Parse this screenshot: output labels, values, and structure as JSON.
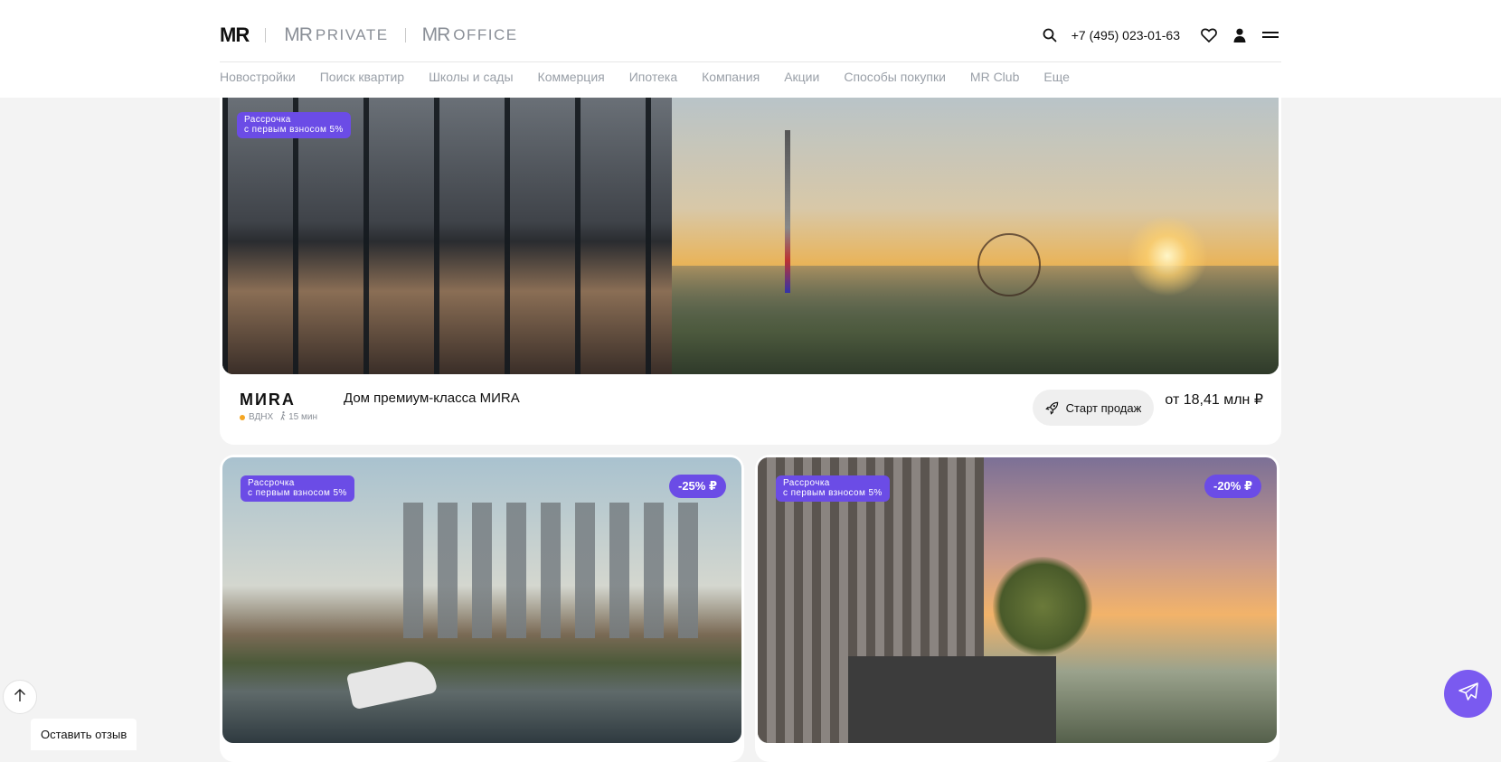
{
  "header": {
    "logos": [
      {
        "mark": "MR",
        "word": ""
      },
      {
        "mark": "MR",
        "word": "PRIVATE"
      },
      {
        "mark": "MR",
        "word": "OFFICE"
      }
    ],
    "phone": "+7 (495) 023-01-63",
    "icons": [
      "search-icon",
      "heart-icon",
      "user-icon",
      "menu-icon"
    ]
  },
  "nav": {
    "items": [
      "Новостройки",
      "Поиск квартир",
      "Школы и сады",
      "Коммерция",
      "Ипотека",
      "Компания",
      "Акции",
      "Способы покупки",
      "MR Club",
      "Еще"
    ]
  },
  "featured": {
    "badge_line1": "Рассрочка",
    "badge_line2": "с первым взносом 5%",
    "project_logo": "МИRА",
    "metro": "ВДНХ",
    "walk": "15 мин",
    "title": "Дом премиум-класса МИRА",
    "button": "Старт продаж",
    "price": "от 18,41 млн ₽"
  },
  "cards": [
    {
      "badge_line1": "Рассрочка",
      "badge_line2": "с первым взносом 5%",
      "discount": "-25% ₽"
    },
    {
      "badge_line1": "Рассрочка",
      "badge_line2": "с первым взносом 5%",
      "discount": "-20% ₽"
    }
  ],
  "floating": {
    "review": "Оставить отзыв"
  },
  "colors": {
    "accent": "#6b4ce6",
    "telegram": "#7a5af0",
    "metro_dot": "#f5a623"
  }
}
